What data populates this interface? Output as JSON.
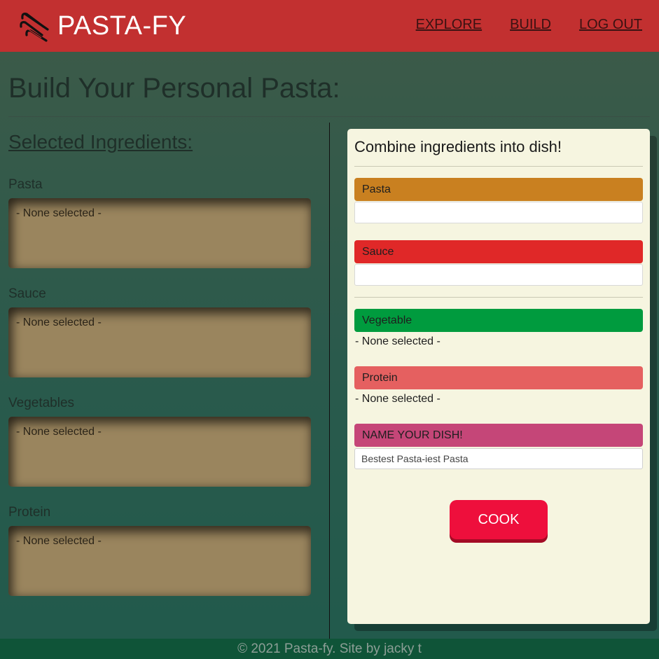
{
  "navbar": {
    "brand": "PASTA-FY",
    "logo_icon": "pasta-logo-icon",
    "links": [
      "EXPLORE",
      "BUILD",
      "LOG OUT"
    ]
  },
  "page": {
    "title": "Build Your Personal Pasta:"
  },
  "selected": {
    "heading": "Selected Ingredients:",
    "groups": [
      {
        "label": "Pasta",
        "value": "- None selected -"
      },
      {
        "label": "Sauce",
        "value": "- None selected -"
      },
      {
        "label": "Vegetables",
        "value": "- None selected -"
      },
      {
        "label": "Protein",
        "value": "- None selected -"
      }
    ]
  },
  "combine": {
    "title": "Combine ingredients into dish!",
    "categories": [
      {
        "label": "Pasta",
        "color": "#c98020",
        "value": ""
      },
      {
        "label": "Sauce",
        "color": "#e02828",
        "value": ""
      },
      {
        "label": "Vegetable",
        "color": "#009b3e",
        "value": "- None selected -"
      },
      {
        "label": "Protein",
        "color": "#e56060",
        "value": "- None selected -"
      }
    ],
    "name_label": "NAME YOUR DISH!",
    "name_color": "#c54678",
    "name_value": "Bestest Pasta-iest Pasta",
    "cook_label": "COOK"
  },
  "footer": {
    "text": "© 2021 Pasta-fy. Site by jacky t"
  }
}
